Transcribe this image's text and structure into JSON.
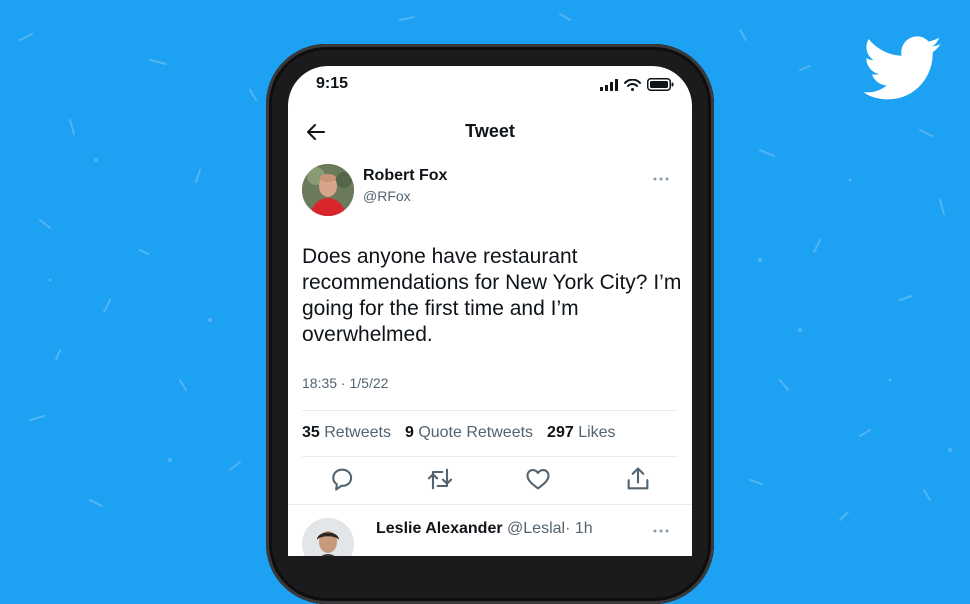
{
  "status_bar": {
    "time": "9:15"
  },
  "nav": {
    "title": "Tweet"
  },
  "tweet": {
    "author_name": "Robert Fox",
    "author_handle": "@RFox",
    "text": "Does anyone have restaurant recommendations for New York City? I’m going for the first time and I’m overwhelmed.",
    "meta": "18:35 · 1/5/22"
  },
  "stats": {
    "retweets_count": "35",
    "retweets_label": "Retweets",
    "quotes_count": "9",
    "quotes_label": "Quote Retweets",
    "likes_count": "297",
    "likes_label": "Likes"
  },
  "reply": {
    "name": "Leslie Alexander",
    "handle": "@Leslal",
    "time": "· 1h"
  },
  "icons": {
    "brand": "twitter-bird-icon",
    "actions": [
      "reply-icon",
      "retweet-icon",
      "like-icon",
      "share-icon"
    ]
  },
  "colors": {
    "background": "#1da1f2",
    "text": "#0f1419",
    "secondary": "#536471"
  }
}
